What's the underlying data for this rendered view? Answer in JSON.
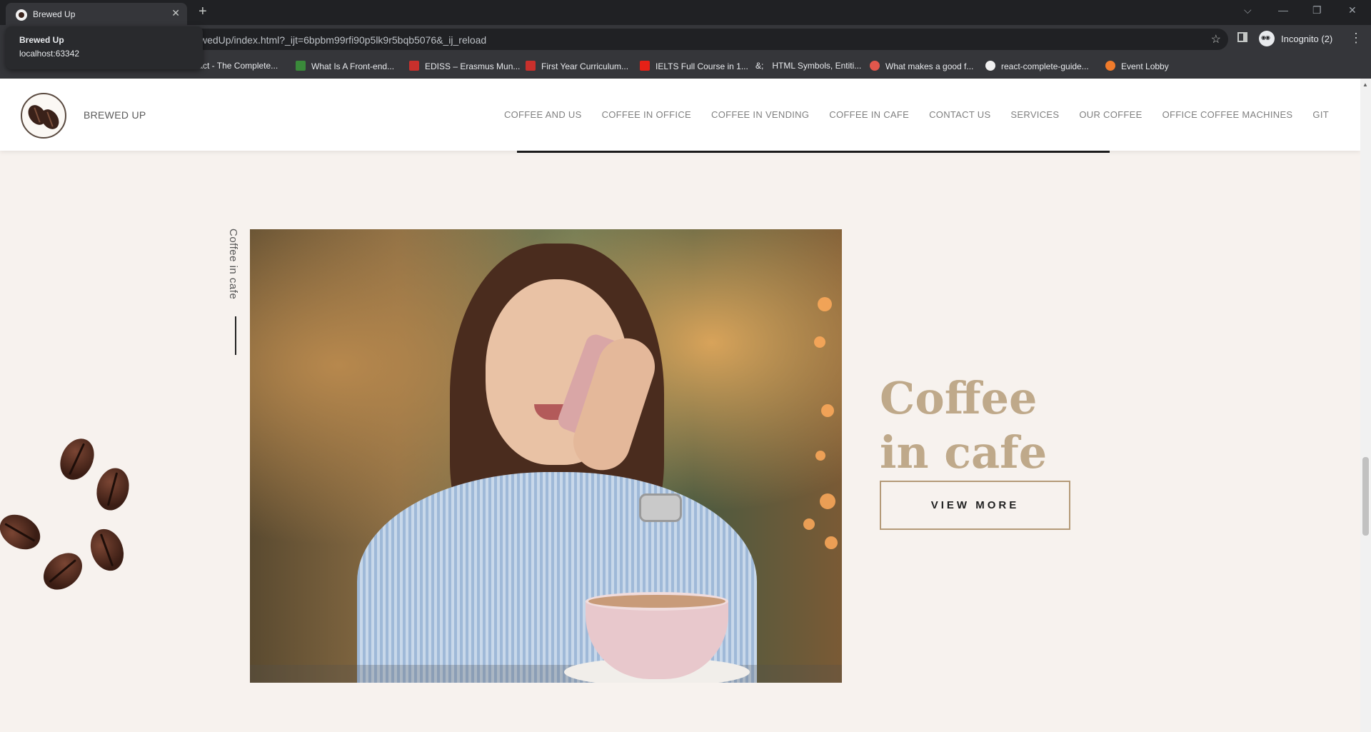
{
  "browser": {
    "tab_title": "Brewed Up",
    "tab_close": "✕",
    "new_tab": "+",
    "window_controls": [
      "⌵",
      "—",
      "❐",
      "✕"
    ],
    "url": "wedUp/index.html?_ijt=6bpbm99rfi90p5lk9r5bqb5076&_ij_reload",
    "star": "☆",
    "incognito_label": "Incognito (2)",
    "menu": "⋮",
    "hovercard": {
      "title": "Brewed Up",
      "subtitle": "localhost:63342"
    },
    "bookmarks": [
      {
        "label": "React - The Complete...",
        "icon_color": "#6a3fbf"
      },
      {
        "label": "What Is A Front-end...",
        "icon_color": "#3a8a3a"
      },
      {
        "label": "EDISS – Erasmus Mun...",
        "icon_color": "#c9302c"
      },
      {
        "label": "First Year Curriculum...",
        "icon_color": "#c9302c"
      },
      {
        "label": "IELTS Full Course in 1...",
        "icon_color": "#e62117"
      },
      {
        "label": "HTML Symbols, Entiti...",
        "icon_color": "#35363a",
        "icon_text": "&;"
      },
      {
        "label": "What makes a good f...",
        "icon_color": "#e2574c"
      },
      {
        "label": "react-complete-guide...",
        "icon_color": "#f0f0f0"
      },
      {
        "label": "Event Lobby",
        "icon_color": "#f07b2b"
      }
    ]
  },
  "site": {
    "brand": "BREWED UP",
    "nav": [
      "COFFEE AND US",
      "COFFEE IN OFFICE",
      "COFFEE IN VENDING",
      "COFFEE IN CAFE",
      "CONTACT US",
      "SERVICES",
      "OUR COFFEE",
      "OFFICE COFFEE MACHINES",
      "GIT"
    ]
  },
  "section": {
    "vertical_label": "Coffee in cafe",
    "title_line1": "Coffee",
    "title_line2": "in cafe",
    "button": "VIEW MORE"
  },
  "colors": {
    "page_bg": "#f7f2ee",
    "accent_gold": "#bfa98a",
    "button_border": "#b49a78",
    "nav_text": "#7f7f7f"
  }
}
